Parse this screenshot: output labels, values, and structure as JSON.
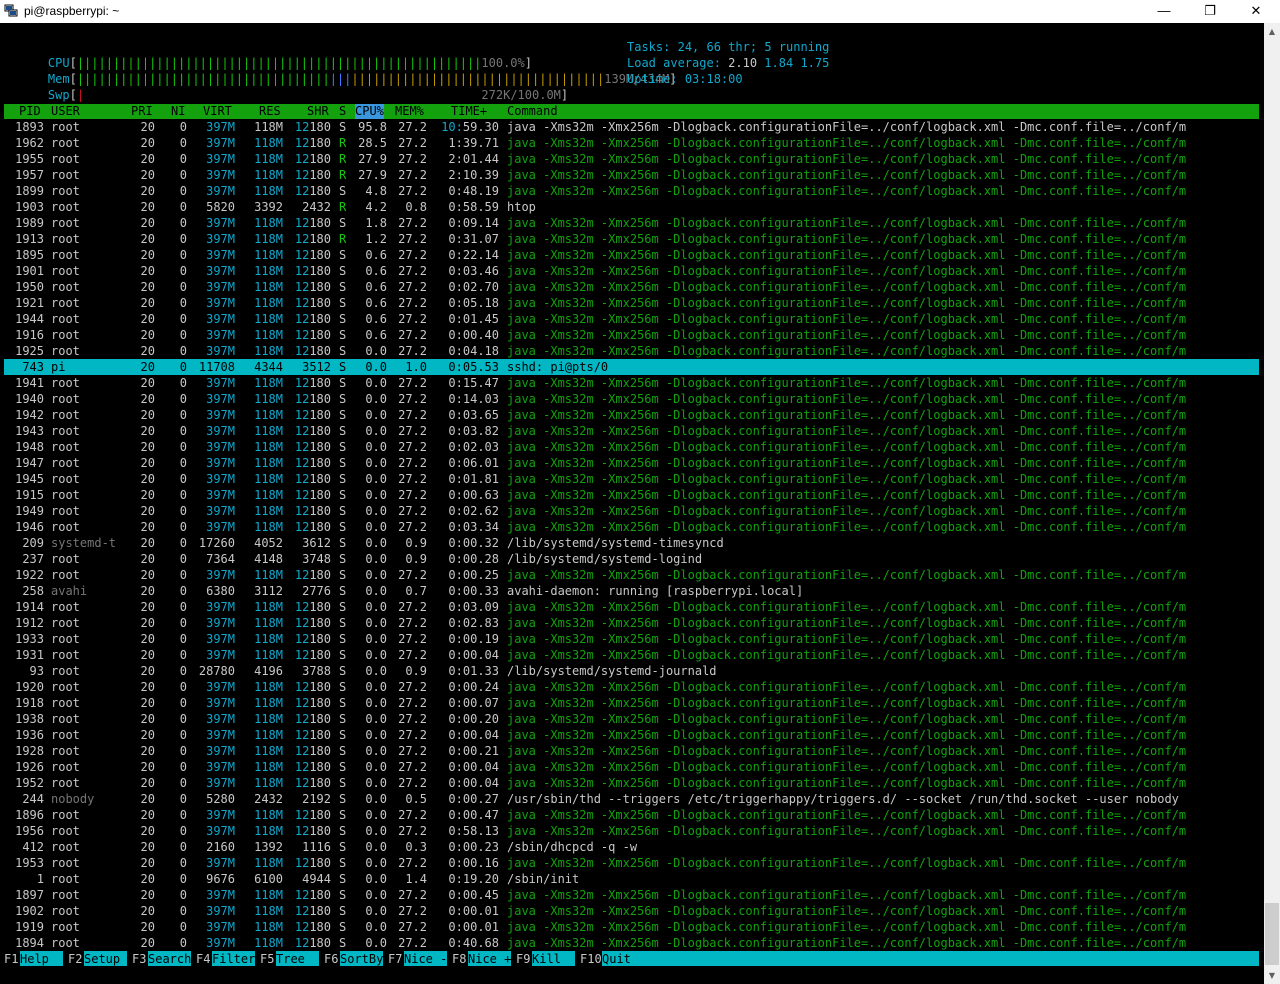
{
  "window": {
    "title": "pi@raspberrypi: ~",
    "minimize": "—",
    "maximize": "❐",
    "close": "✕"
  },
  "meters": {
    "cpu_label": "CPU",
    "cpu_value": "100.0%",
    "mem_label": "Mem",
    "mem_value": "139M/434M",
    "swp_label": "Swp",
    "swp_value": "272K/100.0M",
    "cpu_percent": 100,
    "mem_used_fraction": 0.32,
    "swp_used_fraction": 0.003
  },
  "stats": {
    "tasks_label": "Tasks:",
    "tasks": "24,",
    "threads": "66",
    "thr_label": "thr;",
    "running": "5",
    "running_label": "running",
    "load_label": "Load average:",
    "load1": "2.10",
    "load5": "1.84",
    "load15": "1.75",
    "uptime_label": "Uptime:",
    "uptime": "03:18:00"
  },
  "header": [
    "PID",
    "USER",
    "PRI",
    "NI",
    "VIRT",
    "RES",
    "SHR",
    "S",
    "CPU%",
    "MEM%",
    "TIME+",
    "Command"
  ],
  "processes": [
    [
      "1893",
      "root",
      "20",
      "0",
      "397M",
      "118M",
      "12180",
      "S",
      "95.8",
      "27.2",
      "10:59.30",
      "java -Xms32m -Xmx256m -Dlogback.configurationFile=../conf/logback.xml -Dmc.conf.file=../conf/m",
      "main"
    ],
    [
      "1962",
      "root",
      "20",
      "0",
      "397M",
      "118M",
      "12180",
      "R",
      "28.5",
      "27.2",
      "1:39.71",
      "java -Xms32m -Xmx256m -Dlogback.configurationFile=../conf/logback.xml -Dmc.conf.file=../conf/m",
      "thread"
    ],
    [
      "1955",
      "root",
      "20",
      "0",
      "397M",
      "118M",
      "12180",
      "R",
      "27.9",
      "27.2",
      "2:01.44",
      "java -Xms32m -Xmx256m -Dlogback.configurationFile=../conf/logback.xml -Dmc.conf.file=../conf/m",
      "thread"
    ],
    [
      "1957",
      "root",
      "20",
      "0",
      "397M",
      "118M",
      "12180",
      "R",
      "27.9",
      "27.2",
      "2:10.39",
      "java -Xms32m -Xmx256m -Dlogback.configurationFile=../conf/logback.xml -Dmc.conf.file=../conf/m",
      "thread"
    ],
    [
      "1899",
      "root",
      "20",
      "0",
      "397M",
      "118M",
      "12180",
      "S",
      "4.8",
      "27.2",
      "0:48.19",
      "java -Xms32m -Xmx256m -Dlogback.configurationFile=../conf/logback.xml -Dmc.conf.file=../conf/m",
      "thread"
    ],
    [
      "1903",
      "root",
      "20",
      "0",
      "5820",
      "3392",
      "2432",
      "R",
      "4.2",
      "0.8",
      "0:58.59",
      "htop",
      "main"
    ],
    [
      "1989",
      "root",
      "20",
      "0",
      "397M",
      "118M",
      "12180",
      "S",
      "1.8",
      "27.2",
      "0:09.14",
      "java -Xms32m -Xmx256m -Dlogback.configurationFile=../conf/logback.xml -Dmc.conf.file=../conf/m",
      "thread"
    ],
    [
      "1913",
      "root",
      "20",
      "0",
      "397M",
      "118M",
      "12180",
      "R",
      "1.2",
      "27.2",
      "0:31.07",
      "java -Xms32m -Xmx256m -Dlogback.configurationFile=../conf/logback.xml -Dmc.conf.file=../conf/m",
      "thread"
    ],
    [
      "1895",
      "root",
      "20",
      "0",
      "397M",
      "118M",
      "12180",
      "S",
      "0.6",
      "27.2",
      "0:22.14",
      "java -Xms32m -Xmx256m -Dlogback.configurationFile=../conf/logback.xml -Dmc.conf.file=../conf/m",
      "thread"
    ],
    [
      "1901",
      "root",
      "20",
      "0",
      "397M",
      "118M",
      "12180",
      "S",
      "0.6",
      "27.2",
      "0:03.46",
      "java -Xms32m -Xmx256m -Dlogback.configurationFile=../conf/logback.xml -Dmc.conf.file=../conf/m",
      "thread"
    ],
    [
      "1950",
      "root",
      "20",
      "0",
      "397M",
      "118M",
      "12180",
      "S",
      "0.6",
      "27.2",
      "0:02.70",
      "java -Xms32m -Xmx256m -Dlogback.configurationFile=../conf/logback.xml -Dmc.conf.file=../conf/m",
      "thread"
    ],
    [
      "1921",
      "root",
      "20",
      "0",
      "397M",
      "118M",
      "12180",
      "S",
      "0.6",
      "27.2",
      "0:05.18",
      "java -Xms32m -Xmx256m -Dlogback.configurationFile=../conf/logback.xml -Dmc.conf.file=../conf/m",
      "thread"
    ],
    [
      "1944",
      "root",
      "20",
      "0",
      "397M",
      "118M",
      "12180",
      "S",
      "0.6",
      "27.2",
      "0:01.45",
      "java -Xms32m -Xmx256m -Dlogback.configurationFile=../conf/logback.xml -Dmc.conf.file=../conf/m",
      "thread"
    ],
    [
      "1916",
      "root",
      "20",
      "0",
      "397M",
      "118M",
      "12180",
      "S",
      "0.6",
      "27.2",
      "0:00.40",
      "java -Xms32m -Xmx256m -Dlogback.configurationFile=../conf/logback.xml -Dmc.conf.file=../conf/m",
      "thread"
    ],
    [
      "1925",
      "root",
      "20",
      "0",
      "397M",
      "118M",
      "12180",
      "S",
      "0.0",
      "27.2",
      "0:04.18",
      "java -Xms32m -Xmx256m -Dlogback.configurationFile=../conf/logback.xml -Dmc.conf.file=../conf/m",
      "thread"
    ],
    [
      "743",
      "pi",
      "20",
      "0",
      "11708",
      "4344",
      "3512",
      "S",
      "0.0",
      "1.0",
      "0:05.53",
      "sshd: pi@pts/0",
      "selected"
    ],
    [
      "1941",
      "root",
      "20",
      "0",
      "397M",
      "118M",
      "12180",
      "S",
      "0.0",
      "27.2",
      "0:15.47",
      "java -Xms32m -Xmx256m -Dlogback.configurationFile=../conf/logback.xml -Dmc.conf.file=../conf/m",
      "thread"
    ],
    [
      "1940",
      "root",
      "20",
      "0",
      "397M",
      "118M",
      "12180",
      "S",
      "0.0",
      "27.2",
      "0:14.03",
      "java -Xms32m -Xmx256m -Dlogback.configurationFile=../conf/logback.xml -Dmc.conf.file=../conf/m",
      "thread"
    ],
    [
      "1942",
      "root",
      "20",
      "0",
      "397M",
      "118M",
      "12180",
      "S",
      "0.0",
      "27.2",
      "0:03.65",
      "java -Xms32m -Xmx256m -Dlogback.configurationFile=../conf/logback.xml -Dmc.conf.file=../conf/m",
      "thread"
    ],
    [
      "1943",
      "root",
      "20",
      "0",
      "397M",
      "118M",
      "12180",
      "S",
      "0.0",
      "27.2",
      "0:03.82",
      "java -Xms32m -Xmx256m -Dlogback.configurationFile=../conf/logback.xml -Dmc.conf.file=../conf/m",
      "thread"
    ],
    [
      "1948",
      "root",
      "20",
      "0",
      "397M",
      "118M",
      "12180",
      "S",
      "0.0",
      "27.2",
      "0:02.03",
      "java -Xms32m -Xmx256m -Dlogback.configurationFile=../conf/logback.xml -Dmc.conf.file=../conf/m",
      "thread"
    ],
    [
      "1947",
      "root",
      "20",
      "0",
      "397M",
      "118M",
      "12180",
      "S",
      "0.0",
      "27.2",
      "0:06.01",
      "java -Xms32m -Xmx256m -Dlogback.configurationFile=../conf/logback.xml -Dmc.conf.file=../conf/m",
      "thread"
    ],
    [
      "1945",
      "root",
      "20",
      "0",
      "397M",
      "118M",
      "12180",
      "S",
      "0.0",
      "27.2",
      "0:01.81",
      "java -Xms32m -Xmx256m -Dlogback.configurationFile=../conf/logback.xml -Dmc.conf.file=../conf/m",
      "thread"
    ],
    [
      "1915",
      "root",
      "20",
      "0",
      "397M",
      "118M",
      "12180",
      "S",
      "0.0",
      "27.2",
      "0:00.63",
      "java -Xms32m -Xmx256m -Dlogback.configurationFile=../conf/logback.xml -Dmc.conf.file=../conf/m",
      "thread"
    ],
    [
      "1949",
      "root",
      "20",
      "0",
      "397M",
      "118M",
      "12180",
      "S",
      "0.0",
      "27.2",
      "0:02.62",
      "java -Xms32m -Xmx256m -Dlogback.configurationFile=../conf/logback.xml -Dmc.conf.file=../conf/m",
      "thread"
    ],
    [
      "1946",
      "root",
      "20",
      "0",
      "397M",
      "118M",
      "12180",
      "S",
      "0.0",
      "27.2",
      "0:03.34",
      "java -Xms32m -Xmx256m -Dlogback.configurationFile=../conf/logback.xml -Dmc.conf.file=../conf/m",
      "thread"
    ],
    [
      "209",
      "systemd-t",
      "20",
      "0",
      "17260",
      "4052",
      "3612",
      "S",
      "0.0",
      "0.9",
      "0:00.32",
      "/lib/systemd/systemd-timesyncd",
      "main-graysuser"
    ],
    [
      "237",
      "root",
      "20",
      "0",
      "7364",
      "4148",
      "3748",
      "S",
      "0.0",
      "0.9",
      "0:00.28",
      "/lib/systemd/systemd-logind",
      "main"
    ],
    [
      "1922",
      "root",
      "20",
      "0",
      "397M",
      "118M",
      "12180",
      "S",
      "0.0",
      "27.2",
      "0:00.25",
      "java -Xms32m -Xmx256m -Dlogback.configurationFile=../conf/logback.xml -Dmc.conf.file=../conf/m",
      "thread"
    ],
    [
      "258",
      "avahi",
      "20",
      "0",
      "6380",
      "3112",
      "2776",
      "S",
      "0.0",
      "0.7",
      "0:00.33",
      "avahi-daemon: running [raspberrypi.local]",
      "main-graysuser"
    ],
    [
      "1914",
      "root",
      "20",
      "0",
      "397M",
      "118M",
      "12180",
      "S",
      "0.0",
      "27.2",
      "0:03.09",
      "java -Xms32m -Xmx256m -Dlogback.configurationFile=../conf/logback.xml -Dmc.conf.file=../conf/m",
      "thread"
    ],
    [
      "1912",
      "root",
      "20",
      "0",
      "397M",
      "118M",
      "12180",
      "S",
      "0.0",
      "27.2",
      "0:02.83",
      "java -Xms32m -Xmx256m -Dlogback.configurationFile=../conf/logback.xml -Dmc.conf.file=../conf/m",
      "thread"
    ],
    [
      "1933",
      "root",
      "20",
      "0",
      "397M",
      "118M",
      "12180",
      "S",
      "0.0",
      "27.2",
      "0:00.19",
      "java -Xms32m -Xmx256m -Dlogback.configurationFile=../conf/logback.xml -Dmc.conf.file=../conf/m",
      "thread"
    ],
    [
      "1931",
      "root",
      "20",
      "0",
      "397M",
      "118M",
      "12180",
      "S",
      "0.0",
      "27.2",
      "0:00.04",
      "java -Xms32m -Xmx256m -Dlogback.configurationFile=../conf/logback.xml -Dmc.conf.file=../conf/m",
      "thread"
    ],
    [
      "93",
      "root",
      "20",
      "0",
      "28780",
      "4196",
      "3788",
      "S",
      "0.0",
      "0.9",
      "0:01.33",
      "/lib/systemd/systemd-journald",
      "main"
    ],
    [
      "1920",
      "root",
      "20",
      "0",
      "397M",
      "118M",
      "12180",
      "S",
      "0.0",
      "27.2",
      "0:00.24",
      "java -Xms32m -Xmx256m -Dlogback.configurationFile=../conf/logback.xml -Dmc.conf.file=../conf/m",
      "thread"
    ],
    [
      "1918",
      "root",
      "20",
      "0",
      "397M",
      "118M",
      "12180",
      "S",
      "0.0",
      "27.2",
      "0:00.07",
      "java -Xms32m -Xmx256m -Dlogback.configurationFile=../conf/logback.xml -Dmc.conf.file=../conf/m",
      "thread"
    ],
    [
      "1938",
      "root",
      "20",
      "0",
      "397M",
      "118M",
      "12180",
      "S",
      "0.0",
      "27.2",
      "0:00.20",
      "java -Xms32m -Xmx256m -Dlogback.configurationFile=../conf/logback.xml -Dmc.conf.file=../conf/m",
      "thread"
    ],
    [
      "1936",
      "root",
      "20",
      "0",
      "397M",
      "118M",
      "12180",
      "S",
      "0.0",
      "27.2",
      "0:00.04",
      "java -Xms32m -Xmx256m -Dlogback.configurationFile=../conf/logback.xml -Dmc.conf.file=../conf/m",
      "thread"
    ],
    [
      "1928",
      "root",
      "20",
      "0",
      "397M",
      "118M",
      "12180",
      "S",
      "0.0",
      "27.2",
      "0:00.21",
      "java -Xms32m -Xmx256m -Dlogback.configurationFile=../conf/logback.xml -Dmc.conf.file=../conf/m",
      "thread"
    ],
    [
      "1926",
      "root",
      "20",
      "0",
      "397M",
      "118M",
      "12180",
      "S",
      "0.0",
      "27.2",
      "0:00.04",
      "java -Xms32m -Xmx256m -Dlogback.configurationFile=../conf/logback.xml -Dmc.conf.file=../conf/m",
      "thread"
    ],
    [
      "1952",
      "root",
      "20",
      "0",
      "397M",
      "118M",
      "12180",
      "S",
      "0.0",
      "27.2",
      "0:00.04",
      "java -Xms32m -Xmx256m -Dlogback.configurationFile=../conf/logback.xml -Dmc.conf.file=../conf/m",
      "thread"
    ],
    [
      "244",
      "nobody",
      "20",
      "0",
      "5280",
      "2432",
      "2192",
      "S",
      "0.0",
      "0.5",
      "0:00.27",
      "/usr/sbin/thd --triggers /etc/triggerhappy/triggers.d/ --socket /run/thd.socket --user nobody",
      "main-graysuser"
    ],
    [
      "1896",
      "root",
      "20",
      "0",
      "397M",
      "118M",
      "12180",
      "S",
      "0.0",
      "27.2",
      "0:00.47",
      "java -Xms32m -Xmx256m -Dlogback.configurationFile=../conf/logback.xml -Dmc.conf.file=../conf/m",
      "thread"
    ],
    [
      "1956",
      "root",
      "20",
      "0",
      "397M",
      "118M",
      "12180",
      "S",
      "0.0",
      "27.2",
      "0:58.13",
      "java -Xms32m -Xmx256m -Dlogback.configurationFile=../conf/logback.xml -Dmc.conf.file=../conf/m",
      "thread"
    ],
    [
      "412",
      "root",
      "20",
      "0",
      "2160",
      "1392",
      "1116",
      "S",
      "0.0",
      "0.3",
      "0:00.23",
      "/sbin/dhcpcd -q -w",
      "main"
    ],
    [
      "1953",
      "root",
      "20",
      "0",
      "397M",
      "118M",
      "12180",
      "S",
      "0.0",
      "27.2",
      "0:00.16",
      "java -Xms32m -Xmx256m -Dlogback.configurationFile=../conf/logback.xml -Dmc.conf.file=../conf/m",
      "thread"
    ],
    [
      "1",
      "root",
      "20",
      "0",
      "9676",
      "6100",
      "4944",
      "S",
      "0.0",
      "1.4",
      "0:19.20",
      "/sbin/init",
      "main"
    ],
    [
      "1897",
      "root",
      "20",
      "0",
      "397M",
      "118M",
      "12180",
      "S",
      "0.0",
      "27.2",
      "0:00.45",
      "java -Xms32m -Xmx256m -Dlogback.configurationFile=../conf/logback.xml -Dmc.conf.file=../conf/m",
      "thread"
    ],
    [
      "1902",
      "root",
      "20",
      "0",
      "397M",
      "118M",
      "12180",
      "S",
      "0.0",
      "27.2",
      "0:00.01",
      "java -Xms32m -Xmx256m -Dlogback.configurationFile=../conf/logback.xml -Dmc.conf.file=../conf/m",
      "thread"
    ],
    [
      "1919",
      "root",
      "20",
      "0",
      "397M",
      "118M",
      "12180",
      "S",
      "0.0",
      "27.2",
      "0:00.01",
      "java -Xms32m -Xmx256m -Dlogback.configurationFile=../conf/logback.xml -Dmc.conf.file=../conf/m",
      "thread"
    ],
    [
      "1894",
      "root",
      "20",
      "0",
      "397M",
      "118M",
      "12180",
      "S",
      "0.0",
      "27.2",
      "0:40.68",
      "java -Xms32m -Xmx256m -Dlogback.configurationFile=../conf/logback.xml -Dmc.conf.file=../conf/m",
      "thread"
    ]
  ],
  "footer": [
    {
      "key": "F1",
      "label": "Help  "
    },
    {
      "key": "F2",
      "label": "Setup "
    },
    {
      "key": "F3",
      "label": "Search"
    },
    {
      "key": "F4",
      "label": "Filter"
    },
    {
      "key": "F5",
      "label": "Tree  "
    },
    {
      "key": "F6",
      "label": "SortBy"
    },
    {
      "key": "F7",
      "label": "Nice -"
    },
    {
      "key": "F8",
      "label": "Nice +"
    },
    {
      "key": "F9",
      "label": "Kill  "
    },
    {
      "key": "F10",
      "label": "Quit"
    }
  ],
  "colors": {
    "green": "#13a10e",
    "cyan": "#00b7c3",
    "text": "#c8c8c8",
    "bg": "#000000"
  }
}
